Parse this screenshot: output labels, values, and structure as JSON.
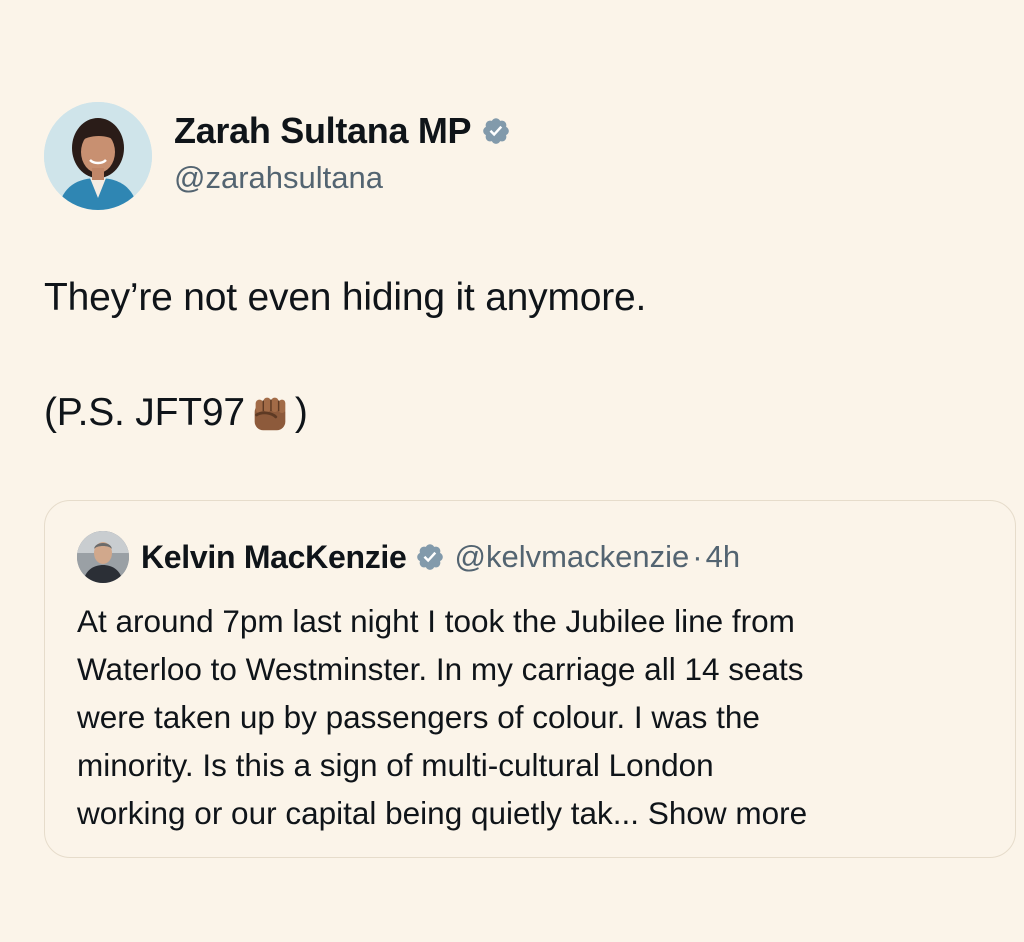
{
  "tweet": {
    "author": {
      "name": "Zarah Sultana MP",
      "handle": "@zarahsultana",
      "verified_icon": "verified-badge-icon"
    },
    "text_line_1": "They’re not even hiding it anymore.",
    "text_line_2_prefix": "(P.S. JFT97",
    "text_line_2_suffix": ")",
    "emoji": "raised-fist-icon"
  },
  "quote": {
    "author": {
      "name": "Kelvin MacKenzie",
      "handle": "@kelvmackenzie",
      "separator": "·",
      "time": "4h"
    },
    "lines": [
      "At around 7pm last night I took the Jubilee line from",
      "Waterloo to Westminster. In my carriage all 14 seats",
      "were taken up by passengers of colour. I was the",
      "minority. Is this a sign of multi-cultural London"
    ],
    "last_line_prefix": "working or our capital being quietly tak... ",
    "show_more": "Show more"
  },
  "colors": {
    "background": "#fbf4e9",
    "text": "#0f1419",
    "secondary_text": "#536471",
    "verified_badge": "#829aab",
    "card_border": "#e6dccb"
  }
}
